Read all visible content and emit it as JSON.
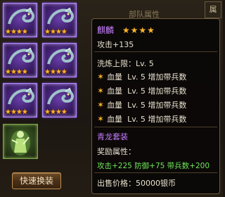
{
  "header_fragment": "部队属性",
  "corner_label": "属",
  "left": {
    "slot_stars": "★★★★",
    "button_label": "快速换装"
  },
  "tooltip": {
    "name": "麒麟",
    "name_stars": "★★★★",
    "attack": "攻击+135",
    "refine_limit": "洗炼上限：Lv. 5",
    "attributes": [
      {
        "label": "血量",
        "value": "Lv. 5 增加带兵数"
      },
      {
        "label": "血量",
        "value": "Lv. 5 增加带兵数"
      },
      {
        "label": "血量",
        "value": "Lv. 5 增加带兵数"
      },
      {
        "label": "血量",
        "value": "Lv. 5 增加带兵数"
      }
    ],
    "set_name": "青龙套装",
    "bonus_label": "奖励属性：",
    "bonus_values": "攻击+225 防御+75 带兵数+200",
    "price_label": "出售价格：",
    "price_value": "50000银币"
  }
}
